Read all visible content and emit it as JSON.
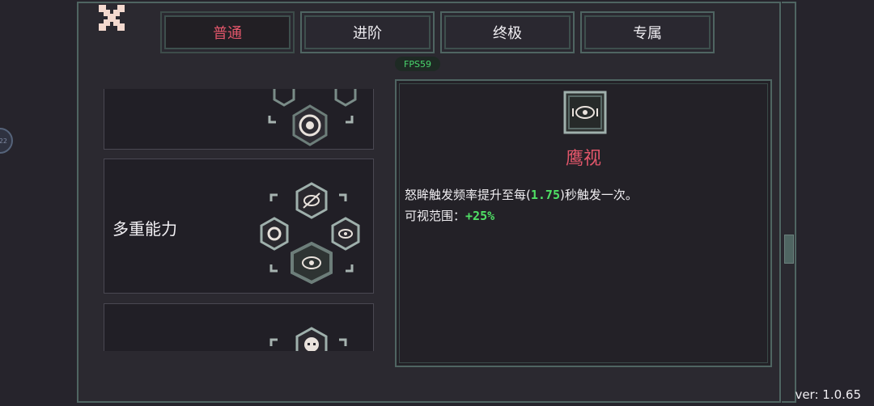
{
  "tabs": [
    {
      "label": "普通",
      "active": true
    },
    {
      "label": "进阶",
      "active": false
    },
    {
      "label": "终极",
      "active": false
    },
    {
      "label": "专属",
      "active": false
    }
  ],
  "fps_label": "FPS59",
  "side_badge": "22",
  "cards": [
    {
      "title": "",
      "partially_visible": true
    },
    {
      "title": "多重能力",
      "partially_visible": false
    },
    {
      "title": "",
      "partially_visible": true
    }
  ],
  "detail": {
    "name": "鹰视",
    "line1_prefix": "怒眸触发频率提升至每(",
    "line1_value": "1.75",
    "line1_suffix": ")秒触发一次。",
    "line2_label": "可视范围：",
    "line2_value": "+25%"
  },
  "version": "ver: 1.0.65",
  "colors": {
    "accent_red": "#e2566a",
    "highlight_green": "#4fe065",
    "frame_teal": "#4f6562"
  }
}
